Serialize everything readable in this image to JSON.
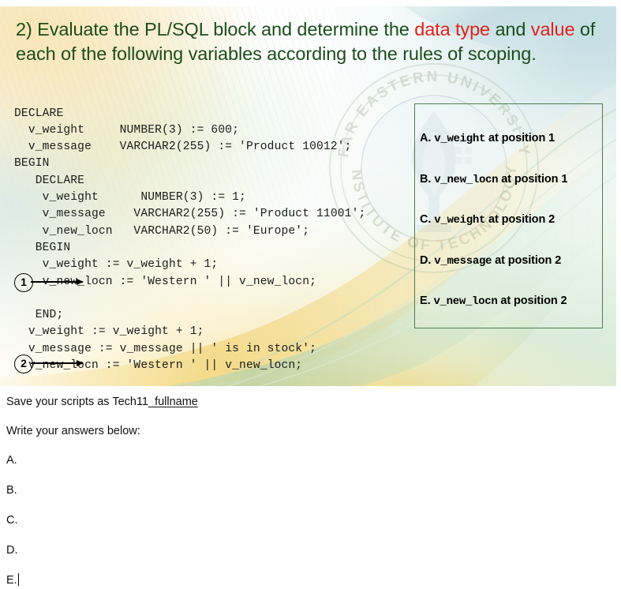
{
  "slide": {
    "title": {
      "part1": "2) Evaluate the PL/SQL block and determine the ",
      "highlight1": "data type",
      "part2": " and ",
      "highlight2": "value",
      "part3": " of each of the following variables according to the rules of scoping."
    },
    "code": "DECLARE\n  v_weight     NUMBER(3) := 600;\n  v_message    VARCHAR2(255) := 'Product 10012';\nBEGIN\n   DECLARE\n    v_weight      NUMBER(3) := 1;\n    v_message    VARCHAR2(255) := 'Product 11001';\n    v_new_locn   VARCHAR2(50) := 'Europe';\n   BEGIN\n    v_weight := v_weight + 1;\n    v_new_locn := 'Western ' || v_new_locn;\n\n   END;\n  v_weight := v_weight + 1;\n  v_message := v_message || ' is in stock';\n  v_new_locn := 'Western ' || v_new_locn;\n\nEND;",
    "markers": [
      {
        "label": "1"
      },
      {
        "label": "2"
      }
    ],
    "options": [
      {
        "letter": "A.",
        "var": "v_weight",
        "tail": "at position 1"
      },
      {
        "letter": "B.",
        "var": "v_new_locn",
        "tail": "at position 1"
      },
      {
        "letter": "C.",
        "var": "v_weight",
        "tail": "at position 2"
      },
      {
        "letter": "D.",
        "var": "v_message",
        "tail": "at position 2"
      },
      {
        "letter": "E.",
        "var": "v_new_locn",
        "tail": "at position 2"
      }
    ],
    "watermark": {
      "top_text": "FAR EASTERN UNIVERSITY",
      "bottom_text": "INSTITUTE OF TECHNOLOGY"
    },
    "colors": {
      "title_green": "#1d4d1c",
      "highlight_red": "#e3211b",
      "box_border_green": "#4e7d4e"
    }
  },
  "document": {
    "save_prefix": "Save your scripts as Tech11",
    "save_underlined": "_fullname",
    "write_answers": "Write your answers below:",
    "answers": [
      {
        "label": "A."
      },
      {
        "label": "B."
      },
      {
        "label": "C."
      },
      {
        "label": "D."
      },
      {
        "label": "E."
      }
    ]
  }
}
